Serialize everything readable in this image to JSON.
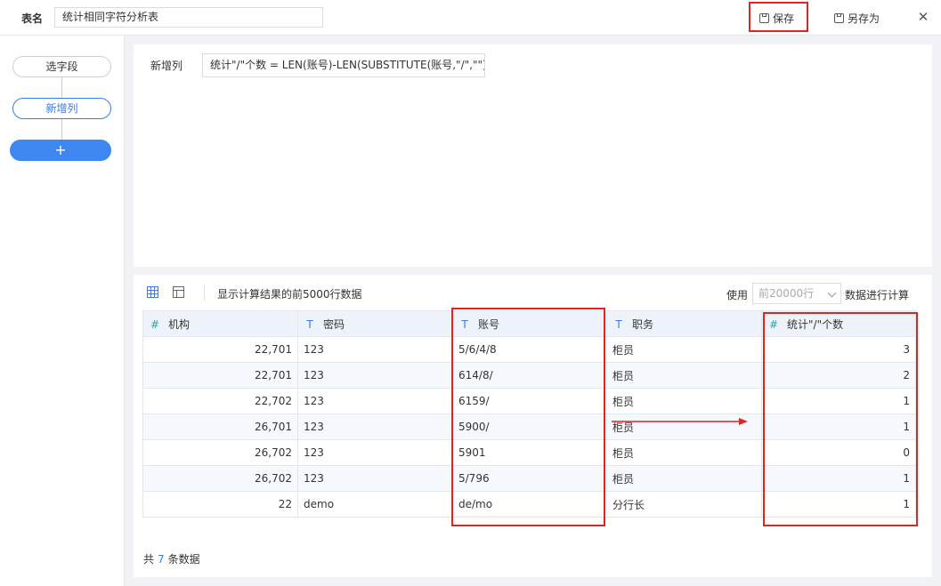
{
  "header": {
    "table_name_label": "表名",
    "table_name_value": "统计相同字符分析表",
    "save_label": "保存",
    "save_as_label": "另存为"
  },
  "sidebar": {
    "nodes": [
      {
        "label": "选字段"
      },
      {
        "label": "新增列"
      }
    ],
    "add_label": "+"
  },
  "formula": {
    "label": "新增列",
    "expression": "统计\"/\"个数 = LEN(账号)-LEN(SUBSTITUTE(账号,\"/\",\"\"))"
  },
  "toolbar": {
    "tip": "显示计算结果的前5000行数据",
    "use_label": "使用",
    "use_placeholder": "前20000行",
    "use_suffix": "数据进行计算"
  },
  "table": {
    "columns": [
      {
        "label": "机构",
        "type": "number",
        "type_glyph": "#"
      },
      {
        "label": "密码",
        "type": "text",
        "type_glyph": "T"
      },
      {
        "label": "账号",
        "type": "text",
        "type_glyph": "T"
      },
      {
        "label": "职务",
        "type": "text",
        "type_glyph": "T"
      },
      {
        "label": "统计\"/\"个数",
        "type": "number",
        "type_glyph": "#"
      }
    ],
    "rows": [
      [
        "22,701",
        "123",
        "5/6/4/8",
        "柜员",
        "3"
      ],
      [
        "22,701",
        "123",
        "614/8/",
        "柜员",
        "2"
      ],
      [
        "22,702",
        "123",
        "6159/",
        "柜员",
        "1"
      ],
      [
        "26,701",
        "123",
        "5900/",
        "柜员",
        "1"
      ],
      [
        "26,702",
        "123",
        "5901",
        "柜员",
        "0"
      ],
      [
        "26,702",
        "123",
        "5/796",
        "柜员",
        "1"
      ],
      [
        "22",
        "demo",
        "de/mo",
        "分行长",
        "1"
      ]
    ]
  },
  "footer": {
    "count_prefix": "共",
    "count_value": "7",
    "count_suffix": "条数据"
  },
  "colors": {
    "accent": "#3b7be8",
    "highlight": "#e02323"
  }
}
